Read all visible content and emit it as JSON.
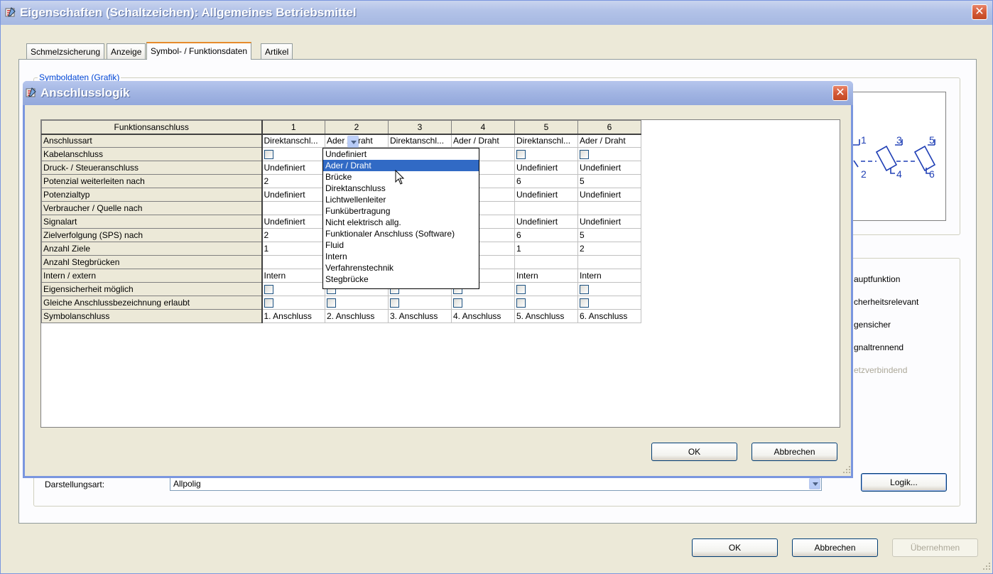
{
  "window": {
    "title": "Eigenschaften (Schaltzeichen): Allgemeines Betriebsmittel",
    "close_label": "✕"
  },
  "tabs": [
    {
      "label": "Schmelzsicherung"
    },
    {
      "label": "Anzeige"
    },
    {
      "label": "Symbol- / Funktionsdaten"
    },
    {
      "label": "Artikel"
    }
  ],
  "symbol_group": {
    "legend": "Symboldaten (Grafik)"
  },
  "preview": {
    "pin_labels": [
      "1",
      "2",
      "3",
      "4",
      "5",
      "6"
    ]
  },
  "right_checks": [
    {
      "label": "auptfunktion",
      "enabled": true
    },
    {
      "label": "cherheitsrelevant",
      "enabled": true
    },
    {
      "label": "gensicher",
      "enabled": true
    },
    {
      "label": "gnaltrennend",
      "enabled": true
    },
    {
      "label": "etzverbindend",
      "enabled": false
    }
  ],
  "darstellung": {
    "label": "Darstellungsart:",
    "value": "Allpolig"
  },
  "logik_button": "Logik...",
  "footer": {
    "ok": "OK",
    "cancel": "Abbrechen",
    "apply": "Übernehmen"
  },
  "dialog": {
    "title": "Anschlusslogik",
    "close_label": "✕",
    "ok": "OK",
    "cancel": "Abbrechen",
    "grid": {
      "corner": "Funktionsanschluss",
      "columns": [
        "1",
        "2",
        "3",
        "4",
        "5",
        "6"
      ],
      "rows": [
        {
          "label": "Anschlussart",
          "cells": [
            "Direktanschl...",
            "Ader / Draht",
            "Direktanschl...",
            "Ader / Draht",
            "Direktanschl...",
            "Ader / Draht"
          ]
        },
        {
          "label": "Kabelanschluss",
          "cells": [
            "[cb]",
            "",
            "",
            "",
            "[cb]",
            "[cb]"
          ]
        },
        {
          "label": "Druck- / Steueranschluss",
          "cells": [
            "Undefiniert",
            "",
            "",
            "iert",
            "Undefiniert",
            "Undefiniert"
          ]
        },
        {
          "label": "Potenzial weiterleiten nach",
          "cells": [
            "2",
            "",
            "",
            "",
            "6",
            "5"
          ]
        },
        {
          "label": "Potenzialtyp",
          "cells": [
            "Undefiniert",
            "",
            "",
            "iert",
            "Undefiniert",
            "Undefiniert"
          ]
        },
        {
          "label": "Verbraucher / Quelle nach",
          "cells": [
            "",
            "",
            "",
            "",
            "",
            ""
          ]
        },
        {
          "label": "Signalart",
          "cells": [
            "Undefiniert",
            "",
            "",
            "iert",
            "Undefiniert",
            "Undefiniert"
          ]
        },
        {
          "label": "Zielverfolgung (SPS) nach",
          "cells": [
            "2",
            "",
            "",
            "",
            "6",
            "5"
          ]
        },
        {
          "label": "Anzahl Ziele",
          "cells": [
            "1",
            "",
            "",
            "",
            "1",
            "2"
          ]
        },
        {
          "label": "Anzahl Stegbrücken",
          "cells": [
            "",
            "",
            "",
            "",
            "",
            ""
          ]
        },
        {
          "label": "Intern / extern",
          "cells": [
            "Intern",
            "",
            "",
            "",
            "Intern",
            "Intern"
          ]
        },
        {
          "label": "Eigensicherheit möglich",
          "cells": [
            "[cb]",
            "[cb]",
            "[cb]",
            "[cb]",
            "[cb]",
            "[cb]"
          ]
        },
        {
          "label": "Gleiche Anschlussbezeichnung erlaubt",
          "cells": [
            "[cb]",
            "[cb]",
            "[cb]",
            "[cb]",
            "[cb]",
            "[cb]"
          ]
        },
        {
          "label": "Symbolanschluss",
          "cells": [
            "1. Anschluss",
            "2. Anschluss",
            "3. Anschluss",
            "4. Anschluss",
            "5. Anschluss",
            "6. Anschluss"
          ]
        }
      ]
    },
    "dropdown": {
      "selected_index": 1,
      "options": [
        "Undefiniert",
        "Ader / Draht",
        "Brücke",
        "Direktanschluss",
        "Lichtwellenleiter",
        "Funkübertragung",
        "Nicht elektrisch allg.",
        "Funktionaler Anschluss (Software)",
        "Fluid",
        "Intern",
        "Verfahrenstechnik",
        "Stegbrücke"
      ]
    }
  },
  "colors": {
    "title_bar": "#a6b8e2",
    "selection": "#316ac5",
    "accent_tab": "#e68b2c",
    "symbol_blue": "#1f3fb5"
  }
}
